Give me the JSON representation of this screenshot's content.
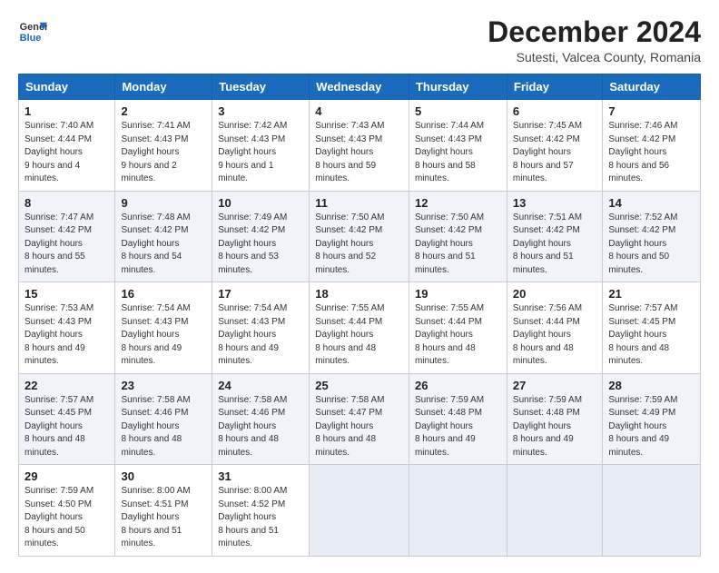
{
  "header": {
    "logo_line1": "General",
    "logo_line2": "Blue",
    "month": "December 2024",
    "location": "Sutesti, Valcea County, Romania"
  },
  "days_of_week": [
    "Sunday",
    "Monday",
    "Tuesday",
    "Wednesday",
    "Thursday",
    "Friday",
    "Saturday"
  ],
  "weeks": [
    [
      {
        "day": 1,
        "sunrise": "7:40 AM",
        "sunset": "4:44 PM",
        "daylight": "9 hours and 4 minutes."
      },
      {
        "day": 2,
        "sunrise": "7:41 AM",
        "sunset": "4:43 PM",
        "daylight": "9 hours and 2 minutes."
      },
      {
        "day": 3,
        "sunrise": "7:42 AM",
        "sunset": "4:43 PM",
        "daylight": "9 hours and 1 minute."
      },
      {
        "day": 4,
        "sunrise": "7:43 AM",
        "sunset": "4:43 PM",
        "daylight": "8 hours and 59 minutes."
      },
      {
        "day": 5,
        "sunrise": "7:44 AM",
        "sunset": "4:43 PM",
        "daylight": "8 hours and 58 minutes."
      },
      {
        "day": 6,
        "sunrise": "7:45 AM",
        "sunset": "4:42 PM",
        "daylight": "8 hours and 57 minutes."
      },
      {
        "day": 7,
        "sunrise": "7:46 AM",
        "sunset": "4:42 PM",
        "daylight": "8 hours and 56 minutes."
      }
    ],
    [
      {
        "day": 8,
        "sunrise": "7:47 AM",
        "sunset": "4:42 PM",
        "daylight": "8 hours and 55 minutes."
      },
      {
        "day": 9,
        "sunrise": "7:48 AM",
        "sunset": "4:42 PM",
        "daylight": "8 hours and 54 minutes."
      },
      {
        "day": 10,
        "sunrise": "7:49 AM",
        "sunset": "4:42 PM",
        "daylight": "8 hours and 53 minutes."
      },
      {
        "day": 11,
        "sunrise": "7:50 AM",
        "sunset": "4:42 PM",
        "daylight": "8 hours and 52 minutes."
      },
      {
        "day": 12,
        "sunrise": "7:50 AM",
        "sunset": "4:42 PM",
        "daylight": "8 hours and 51 minutes."
      },
      {
        "day": 13,
        "sunrise": "7:51 AM",
        "sunset": "4:42 PM",
        "daylight": "8 hours and 51 minutes."
      },
      {
        "day": 14,
        "sunrise": "7:52 AM",
        "sunset": "4:42 PM",
        "daylight": "8 hours and 50 minutes."
      }
    ],
    [
      {
        "day": 15,
        "sunrise": "7:53 AM",
        "sunset": "4:43 PM",
        "daylight": "8 hours and 49 minutes."
      },
      {
        "day": 16,
        "sunrise": "7:54 AM",
        "sunset": "4:43 PM",
        "daylight": "8 hours and 49 minutes."
      },
      {
        "day": 17,
        "sunrise": "7:54 AM",
        "sunset": "4:43 PM",
        "daylight": "8 hours and 49 minutes."
      },
      {
        "day": 18,
        "sunrise": "7:55 AM",
        "sunset": "4:44 PM",
        "daylight": "8 hours and 48 minutes."
      },
      {
        "day": 19,
        "sunrise": "7:55 AM",
        "sunset": "4:44 PM",
        "daylight": "8 hours and 48 minutes."
      },
      {
        "day": 20,
        "sunrise": "7:56 AM",
        "sunset": "4:44 PM",
        "daylight": "8 hours and 48 minutes."
      },
      {
        "day": 21,
        "sunrise": "7:57 AM",
        "sunset": "4:45 PM",
        "daylight": "8 hours and 48 minutes."
      }
    ],
    [
      {
        "day": 22,
        "sunrise": "7:57 AM",
        "sunset": "4:45 PM",
        "daylight": "8 hours and 48 minutes."
      },
      {
        "day": 23,
        "sunrise": "7:58 AM",
        "sunset": "4:46 PM",
        "daylight": "8 hours and 48 minutes."
      },
      {
        "day": 24,
        "sunrise": "7:58 AM",
        "sunset": "4:46 PM",
        "daylight": "8 hours and 48 minutes."
      },
      {
        "day": 25,
        "sunrise": "7:58 AM",
        "sunset": "4:47 PM",
        "daylight": "8 hours and 48 minutes."
      },
      {
        "day": 26,
        "sunrise": "7:59 AM",
        "sunset": "4:48 PM",
        "daylight": "8 hours and 49 minutes."
      },
      {
        "day": 27,
        "sunrise": "7:59 AM",
        "sunset": "4:48 PM",
        "daylight": "8 hours and 49 minutes."
      },
      {
        "day": 28,
        "sunrise": "7:59 AM",
        "sunset": "4:49 PM",
        "daylight": "8 hours and 49 minutes."
      }
    ],
    [
      {
        "day": 29,
        "sunrise": "7:59 AM",
        "sunset": "4:50 PM",
        "daylight": "8 hours and 50 minutes."
      },
      {
        "day": 30,
        "sunrise": "8:00 AM",
        "sunset": "4:51 PM",
        "daylight": "8 hours and 51 minutes."
      },
      {
        "day": 31,
        "sunrise": "8:00 AM",
        "sunset": "4:52 PM",
        "daylight": "8 hours and 51 minutes."
      },
      null,
      null,
      null,
      null
    ]
  ]
}
